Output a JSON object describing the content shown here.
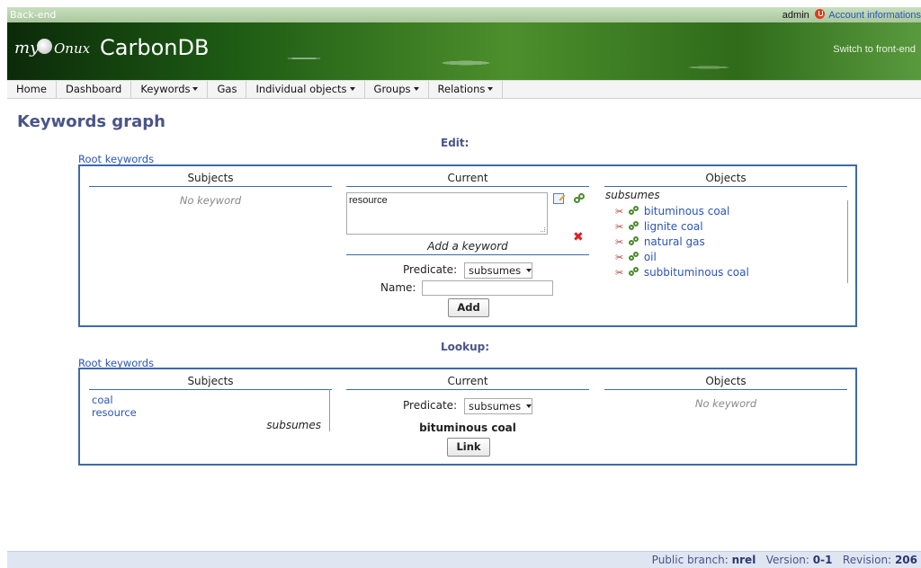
{
  "topbar": {
    "left_label": "Back-end",
    "user": "admin",
    "account_link": "Account informations"
  },
  "banner": {
    "logo_my": "my",
    "logo_brand": "Onux",
    "app_title": "CarbonDB",
    "switch_link": "Switch to front-end"
  },
  "menu": {
    "items": [
      {
        "label": "Home",
        "has_dropdown": false
      },
      {
        "label": "Dashboard",
        "has_dropdown": false
      },
      {
        "label": "Keywords",
        "has_dropdown": true
      },
      {
        "label": "Gas",
        "has_dropdown": false
      },
      {
        "label": "Individual objects",
        "has_dropdown": true
      },
      {
        "label": "Groups",
        "has_dropdown": true
      },
      {
        "label": "Relations",
        "has_dropdown": true
      }
    ]
  },
  "page": {
    "title": "Keywords graph"
  },
  "edit": {
    "title": "Edit:",
    "root_link": "Root keywords",
    "subjects_header": "Subjects",
    "subjects_empty": "No keyword",
    "current_header": "Current",
    "current_value": "resource",
    "add_keyword_label": "Add a keyword",
    "predicate_label": "Predicate:",
    "predicate_value": "subsumes",
    "name_label": "Name:",
    "name_value": "",
    "add_button": "Add",
    "objects_header": "Objects",
    "objects_predicate": "subsumes",
    "objects": [
      "bituminous coal",
      "lignite coal",
      "natural gas",
      "oil",
      "subbituminous coal"
    ]
  },
  "lookup": {
    "title": "Lookup:",
    "root_link": "Root keywords",
    "subjects_header": "Subjects",
    "subjects": [
      "coal",
      "resource"
    ],
    "subjects_predicate": "subsumes",
    "current_header": "Current",
    "predicate_label": "Predicate:",
    "predicate_value": "subsumes",
    "current_value": "bituminous coal",
    "link_button": "Link",
    "objects_header": "Objects",
    "objects_empty": "No keyword"
  },
  "footer": {
    "branch_label": "Public branch:",
    "branch_value": "nrel",
    "version_label": "Version:",
    "version_value": "0-1",
    "revision_label": "Revision:",
    "revision_value": "206"
  },
  "colors": {
    "accent": "#4a5488",
    "link": "#2a54b8",
    "panel_border": "#3d6aa8",
    "delete": "#d82222"
  }
}
